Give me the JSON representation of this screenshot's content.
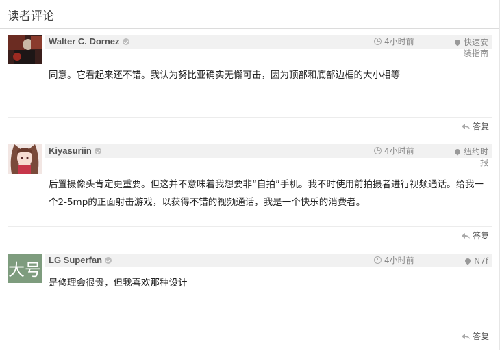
{
  "section_title": "读者评论",
  "comments": [
    {
      "author": "Walter C. Dornez",
      "time": "4小时前",
      "location": "快速安装指南",
      "text": "同意。它看起来还不错。我认为努比亚确实无懈可击，因为顶部和底部边框的大小相等",
      "reply_label": "答复",
      "avatar_icon": "avatar-image"
    },
    {
      "author": "Kiyasuriin",
      "time": "4小时前",
      "location": "纽约时报",
      "text": "后置摄像头肯定更重要。但这并不意味着我想要非“自拍”手机。我不时使用前拍摄者进行视频通话。给我一个2-5mp的正面射击游戏，以获得不错的视频通话，我是一个快乐的消费者。",
      "reply_label": "答复",
      "avatar_icon": "avatar-image"
    },
    {
      "author": "LG Superfan",
      "time": "4小时前",
      "location": "N7f",
      "text": "是修理会很贵，但我喜欢那种设计",
      "reply_label": "答复",
      "avatar_text": "大号"
    }
  ],
  "colors": {
    "meta_bg": "#f1f1f1",
    "avatar_green": "#7e9c7e"
  }
}
